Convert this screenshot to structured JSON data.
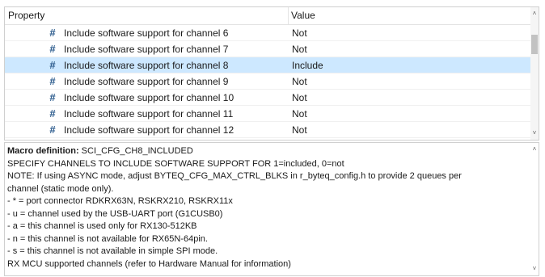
{
  "grid": {
    "header": {
      "property": "Property",
      "value": "Value"
    },
    "rows": [
      {
        "property": "Include software support for channel 6",
        "value": "Not",
        "selected": false
      },
      {
        "property": "Include software support for channel 7",
        "value": "Not",
        "selected": false
      },
      {
        "property": "Include software support for channel 8",
        "value": "Include",
        "selected": true
      },
      {
        "property": "Include software support for channel 9",
        "value": "Not",
        "selected": false
      },
      {
        "property": "Include software support for channel 10",
        "value": "Not",
        "selected": false
      },
      {
        "property": "Include software support for channel 11",
        "value": "Not",
        "selected": false
      },
      {
        "property": "Include software support for channel 12",
        "value": "Not",
        "selected": false
      }
    ],
    "row_icon_glyph": "#",
    "row_icon": "hash-icon"
  },
  "description": {
    "macro_label": "Macro definition:",
    "macro_name": "SCI_CFG_CH8_INCLUDED",
    "lines": [
      "SPECIFY CHANNELS TO INCLUDE SOFTWARE SUPPORT FOR 1=included, 0=not",
      "NOTE: If using ASYNC mode, adjust BYTEQ_CFG_MAX_CTRL_BLKS in r_byteq_config.h to provide 2 queues per",
      "channel (static mode only).",
      "- * = port connector RDKRX63N, RSKRX210, RSKRX11x",
      "- u = channel used by the USB-UART port (G1CUSB0)",
      "- a = this channel is used only for RX130-512KB",
      "- n = this channel is not available for RX65N-64pin.",
      "- s = this channel is not available in simple SPI mode.",
      "RX MCU supported channels (refer to Hardware Manual for information)"
    ]
  },
  "scroll_icons": {
    "up": "˄",
    "down": "˅"
  },
  "colors": {
    "selected_row": "#cde8ff",
    "hash_icon": "#2a5a8c",
    "border": "#d0d0d0"
  }
}
